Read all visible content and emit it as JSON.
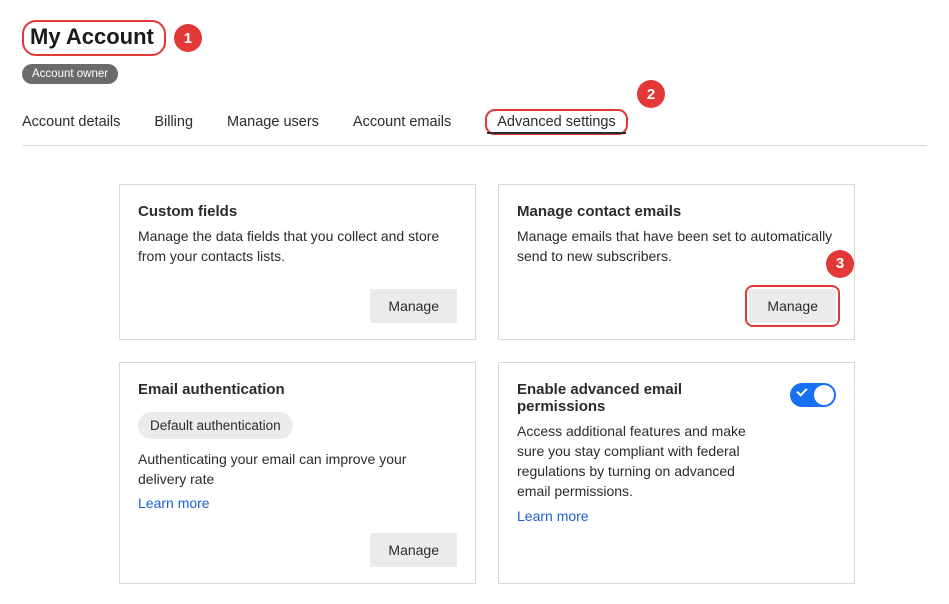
{
  "header": {
    "title": "My Account",
    "role_badge": "Account owner"
  },
  "tabs": {
    "items": [
      "Account details",
      "Billing",
      "Manage users",
      "Account emails",
      "Advanced settings"
    ],
    "active_index": 4
  },
  "cards": {
    "custom_fields": {
      "title": "Custom fields",
      "desc": "Manage the data fields that you collect and store from your contacts lists.",
      "button": "Manage"
    },
    "contact_emails": {
      "title": "Manage contact emails",
      "desc": "Manage emails that have been set to automatically send to new subscribers.",
      "button": "Manage"
    },
    "email_auth": {
      "title": "Email authentication",
      "pill": "Default authentication",
      "desc": "Authenticating your email can improve your delivery rate",
      "learn_more": "Learn more",
      "button": "Manage"
    },
    "permissions": {
      "title": "Enable advanced email permissions",
      "desc": "Access additional features and make sure you stay compliant with federal regulations by turning on advanced email permissions.",
      "learn_more": "Learn more",
      "toggle_on": true
    }
  },
  "callouts": {
    "c1": "1",
    "c2": "2",
    "c3": "3"
  }
}
